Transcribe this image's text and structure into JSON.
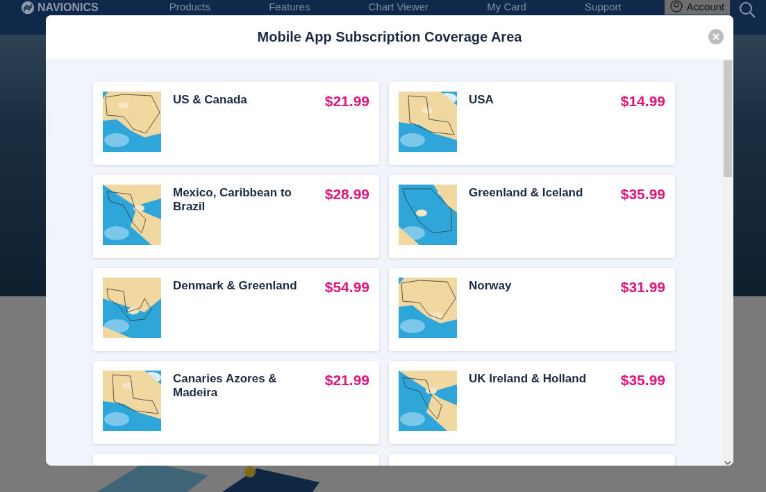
{
  "nav": {
    "logo": "NAVIONICS",
    "items": [
      "Products",
      "Features",
      "Chart Viewer",
      "My Card",
      "Support"
    ],
    "account": "Account"
  },
  "modal": {
    "title": "Mobile App Subscription Coverage Area",
    "products": [
      {
        "kind": "card",
        "name": "US & Canada",
        "price": "$21.99"
      },
      {
        "kind": "card",
        "name": "USA",
        "price": "$14.99"
      },
      {
        "kind": "card",
        "name": "Mexico, Caribbean to Brazil",
        "price": "$28.99"
      },
      {
        "kind": "card",
        "name": "Greenland & Iceland",
        "price": "$35.99"
      },
      {
        "kind": "card",
        "name": "Denmark & Greenland",
        "price": "$54.99"
      },
      {
        "kind": "card",
        "name": "Norway",
        "price": "$31.99"
      },
      {
        "kind": "card",
        "name": "Canaries Azores & Madeira",
        "price": "$21.99"
      },
      {
        "kind": "card",
        "name": "UK Ireland & Holland",
        "price": "$35.99"
      },
      {
        "kind": "partial"
      },
      {
        "kind": "partial"
      }
    ]
  }
}
